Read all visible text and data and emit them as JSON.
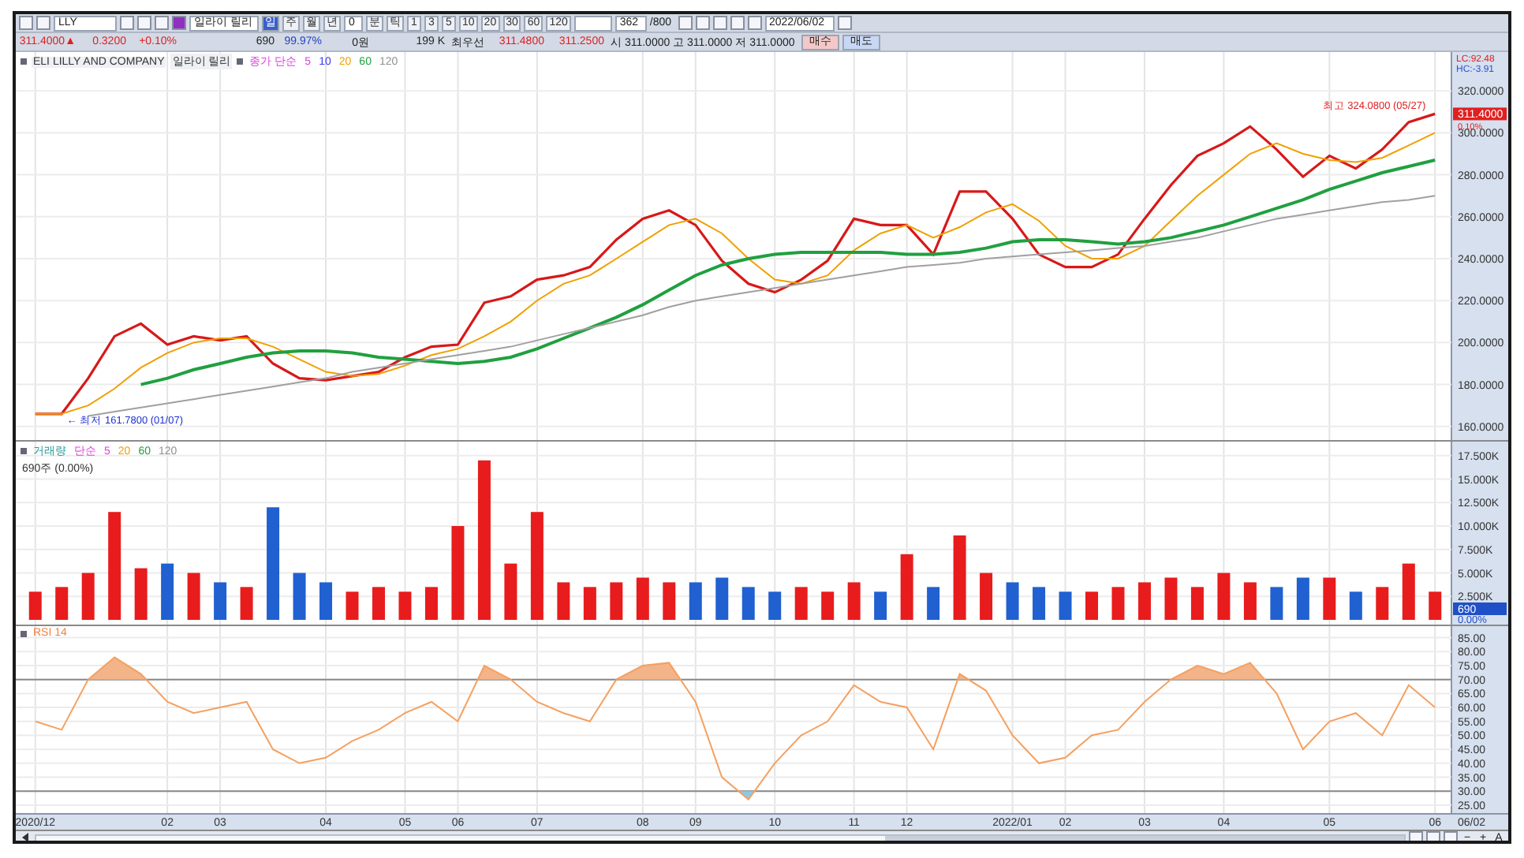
{
  "toolbar": {
    "symbol": "LLY",
    "name": "일라이 릴리",
    "periods": [
      {
        "label": "일",
        "selected": true
      },
      {
        "label": "주",
        "selected": false
      },
      {
        "label": "월",
        "selected": false
      },
      {
        "label": "년",
        "selected": false
      }
    ],
    "n_value": "0",
    "units": [
      {
        "label": "분",
        "selected": false
      },
      {
        "label": "틱",
        "selected": false
      }
    ],
    "intervals": [
      "1",
      "3",
      "5",
      "10",
      "20",
      "30",
      "60",
      "120"
    ],
    "count": "362",
    "max": "/800",
    "date": "2022/06/02"
  },
  "quote": {
    "price": "311.4000▲",
    "change": "0.3200",
    "rate": "+0.10%",
    "volume": "690",
    "ratio": "99.97%",
    "amount": "0원",
    "turnover": "199 K",
    "best_label": "최우선",
    "ask": "311.4800",
    "bid": "311.2500",
    "ohl": "시 311.0000 고 311.0000 저 311.0000",
    "buy": "매수",
    "sell": "매도"
  },
  "price_panel": {
    "company": "ELI LILLY AND COMPANY",
    "name": "일라이 릴리",
    "ma_label": "종가 단순",
    "ma_periods": [
      {
        "label": "5",
        "color": "#e040e0"
      },
      {
        "label": "10",
        "color": "#3a3af0"
      },
      {
        "label": "20",
        "color": "#f0a000"
      },
      {
        "label": "60",
        "color": "#20a040"
      },
      {
        "label": "120",
        "color": "#909090"
      }
    ],
    "high_note": "최고 324.0800 (05/27)",
    "low_note": "← 최저 161.7800 (01/07)",
    "lc": "LC:92.48",
    "hc": "HC:-3.91",
    "last": "311.4000",
    "last_rate": "0.10%",
    "chart_data": {
      "type": "line",
      "series": [
        {
          "color": "#d81818",
          "values": [
            166,
            166,
            183,
            203,
            209,
            199,
            203,
            201,
            203,
            190,
            183,
            182,
            184,
            186,
            193,
            198,
            199,
            219,
            222,
            230,
            232,
            236,
            249,
            259,
            263,
            256,
            239,
            228,
            224,
            230,
            239,
            259,
            256,
            256,
            242,
            272,
            272,
            259,
            242,
            236,
            236,
            242,
            259,
            275,
            289,
            295,
            303,
            292,
            279,
            289,
            283,
            292,
            305,
            309
          ]
        },
        {
          "color": "#f0a000",
          "values": [
            166,
            166,
            170,
            178,
            188,
            195,
            200,
            202,
            202,
            198,
            192,
            186,
            184,
            185,
            189,
            194,
            197,
            203,
            210,
            220,
            228,
            232,
            240,
            248,
            256,
            259,
            252,
            240,
            230,
            228,
            232,
            244,
            252,
            256,
            250,
            255,
            262,
            266,
            258,
            246,
            240,
            240,
            246,
            258,
            270,
            280,
            290,
            295,
            290,
            287,
            286,
            288,
            294,
            300
          ]
        },
        {
          "color": "#20a040",
          "values": [
            null,
            null,
            null,
            null,
            180,
            183,
            187,
            190,
            193,
            195,
            196,
            196,
            195,
            193,
            192,
            191,
            190,
            191,
            193,
            197,
            202,
            207,
            212,
            218,
            225,
            232,
            237,
            240,
            242,
            243,
            243,
            243,
            243,
            242,
            242,
            243,
            245,
            248,
            249,
            249,
            248,
            247,
            248,
            250,
            253,
            256,
            260,
            264,
            268,
            273,
            277,
            281,
            284,
            287
          ]
        },
        {
          "color": "#a0a0a0",
          "values": [
            null,
            null,
            165,
            167,
            169,
            171,
            173,
            175,
            177,
            179,
            181,
            183,
            186,
            188,
            190,
            192,
            194,
            196,
            198,
            201,
            204,
            207,
            210,
            213,
            217,
            220,
            222,
            224,
            226,
            228,
            230,
            232,
            234,
            236,
            237,
            238,
            240,
            241,
            242,
            243,
            244,
            245,
            246,
            248,
            250,
            253,
            256,
            259,
            261,
            263,
            265,
            267,
            268,
            270
          ]
        }
      ],
      "grid": true,
      "ylim": [
        155,
        338.5
      ],
      "yticks": [
        {
          "value": 160,
          "label": "160.0000"
        },
        {
          "value": 180,
          "label": "180.0000"
        },
        {
          "value": 200,
          "label": "200.0000"
        },
        {
          "value": 220,
          "label": "220.0000"
        },
        {
          "value": 240,
          "label": "240.0000"
        },
        {
          "value": 260,
          "label": "260.0000"
        },
        {
          "value": 280,
          "label": "280.0000"
        },
        {
          "value": 300,
          "label": "300.0000"
        },
        {
          "value": 320,
          "label": "320.0000"
        }
      ]
    }
  },
  "volume_panel": {
    "label": "거래량",
    "ma_label": "단순",
    "ma_periods": [
      {
        "label": "5",
        "color": "#e040e0"
      },
      {
        "label": "20",
        "color": "#f0a000"
      },
      {
        "label": "60",
        "color": "#20a040"
      },
      {
        "label": "120",
        "color": "#909090"
      }
    ],
    "sub": "690주 (0.00%)",
    "last": "690",
    "last_rate": "0.00%",
    "chart_data": {
      "type": "bar",
      "stacked": true,
      "series": [
        {
          "color": "#e81c1c",
          "values": [
            3,
            3.5,
            5,
            11.5,
            5.5,
            null,
            5,
            null,
            3.5,
            null,
            null,
            null,
            3,
            3.5,
            3,
            3.5,
            10,
            17,
            6,
            11.5,
            4,
            3.5,
            4,
            4.5,
            4,
            null,
            null,
            null,
            null,
            3.5,
            3,
            4,
            null,
            7,
            null,
            9,
            5,
            null,
            null,
            null,
            3,
            3.5,
            4,
            4.5,
            3.5,
            5,
            4,
            null,
            null,
            4.5,
            null,
            3.5,
            6,
            3
          ]
        },
        {
          "color": "#2060d0",
          "values": [
            null,
            null,
            null,
            null,
            null,
            6,
            null,
            4,
            null,
            12,
            5,
            4,
            null,
            null,
            null,
            null,
            null,
            null,
            null,
            null,
            null,
            null,
            null,
            null,
            null,
            4,
            4.5,
            3.5,
            3,
            null,
            null,
            null,
            3,
            null,
            3.5,
            null,
            null,
            4,
            3.5,
            3,
            null,
            null,
            null,
            null,
            null,
            null,
            null,
            3.5,
            4.5,
            null,
            3,
            null,
            null,
            null
          ]
        }
      ],
      "grid": true,
      "ylim": [
        0,
        19
      ],
      "yticks": [
        {
          "value": 2.5,
          "label": "2.500K"
        },
        {
          "value": 5,
          "label": "5.000K"
        },
        {
          "value": 7.5,
          "label": "7.500K"
        },
        {
          "value": 10,
          "label": "10.000K"
        },
        {
          "value": 12.5,
          "label": "12.500K"
        },
        {
          "value": 15,
          "label": "15.000K"
        },
        {
          "value": 17.5,
          "label": "17.500K"
        }
      ]
    }
  },
  "rsi_panel": {
    "label": "RSI 14",
    "axis_date": "06/02",
    "chart_data": {
      "type": "line",
      "categories": [
        "2020/12",
        null,
        null,
        null,
        null,
        "02",
        null,
        "03",
        null,
        null,
        null,
        "04",
        null,
        null,
        "05",
        null,
        "06",
        null,
        null,
        "07",
        null,
        null,
        null,
        "08",
        null,
        "09",
        null,
        null,
        "10",
        null,
        null,
        "11",
        null,
        "12",
        null,
        null,
        null,
        "2022/01",
        null,
        "02",
        null,
        null,
        "03",
        null,
        null,
        "04",
        null,
        null,
        null,
        "05",
        null,
        null,
        null,
        "06"
      ],
      "series": [
        {
          "color": "#f5a060",
          "values": [
            55,
            52,
            70,
            78,
            72,
            62,
            58,
            60,
            62,
            45,
            40,
            42,
            48,
            52,
            58,
            62,
            55,
            75,
            70,
            62,
            58,
            55,
            70,
            75,
            76,
            62,
            35,
            27,
            40,
            50,
            55,
            68,
            62,
            60,
            45,
            72,
            66,
            50,
            40,
            42,
            50,
            52,
            62,
            70,
            75,
            72,
            76,
            65,
            45,
            55,
            58,
            50,
            68,
            60
          ]
        }
      ],
      "grid": true,
      "ylim": [
        23,
        88
      ],
      "yticks": [
        {
          "value": 25,
          "label": "25.00"
        },
        {
          "value": 30,
          "label": "30.00"
        },
        {
          "value": 35,
          "label": "35.00"
        },
        {
          "value": 40,
          "label": "40.00"
        },
        {
          "value": 45,
          "label": "45.00"
        },
        {
          "value": 50,
          "label": "50.00"
        },
        {
          "value": 55,
          "label": "55.00"
        },
        {
          "value": 60,
          "label": "60.00"
        },
        {
          "value": 65,
          "label": "65.00"
        },
        {
          "value": 70,
          "label": "70.00"
        },
        {
          "value": 75,
          "label": "75.00"
        },
        {
          "value": 80,
          "label": "80.00"
        },
        {
          "value": 85,
          "label": "85.00"
        }
      ]
    }
  },
  "bottom_bar": {
    "buttons": [
      "−",
      "+",
      "A"
    ]
  }
}
